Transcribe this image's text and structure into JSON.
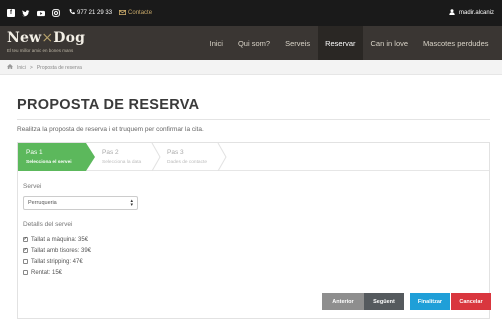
{
  "topbar": {
    "social_icons": [
      "facebook-icon",
      "twitter-icon",
      "youtube-icon",
      "instagram-icon"
    ],
    "phone": "977 21 29 33",
    "contact": "Contacte",
    "user": "madir.alcaniz"
  },
  "brand": {
    "name_a": "New",
    "name_x": "×",
    "name_b": "Dog",
    "tagline": "El teu millor amic en bones mans"
  },
  "menu": [
    {
      "label": "Inici",
      "active": false
    },
    {
      "label": "Qui som?",
      "active": false
    },
    {
      "label": "Serveis",
      "active": false
    },
    {
      "label": "Reservar",
      "active": true
    },
    {
      "label": "Can in love",
      "active": false
    },
    {
      "label": "Mascotes perdudes",
      "active": false
    }
  ],
  "breadcrumb": {
    "home": "Inici",
    "sep": ">",
    "current": "Proposta de reserva"
  },
  "page": {
    "title": "PROPOSTA DE RESERVA",
    "subtitle": "Realitza la proposta de reserva i et truquem per confirmar la cita."
  },
  "steps": [
    {
      "num": "Pas 1",
      "label": "Selecciona el servei"
    },
    {
      "num": "Pas 2",
      "label": "Selecciona la data"
    },
    {
      "num": "Pas 3",
      "label": "Dades de contacte"
    }
  ],
  "form": {
    "servei_label": "Servei",
    "servei_value": "Perruqueria",
    "detalls_label": "Detalls del servei",
    "options": [
      {
        "label": "Tallat a màquina: 35€",
        "checked": true
      },
      {
        "label": "Tallat amb tisores: 39€",
        "checked": true
      },
      {
        "label": "Tallat stripping: 47€",
        "checked": false
      },
      {
        "label": "Rentat: 15€",
        "checked": false
      }
    ]
  },
  "buttons": {
    "anterior": "Anterior",
    "seguent": "Següent",
    "finalitzar": "Finalitzar",
    "cancelar": "Cancelar"
  },
  "colors": {
    "step_active": "#5cb85c",
    "finalitzar": "#1f9fd8",
    "cancelar": "#d9363e",
    "navbar": "#3a3633"
  }
}
